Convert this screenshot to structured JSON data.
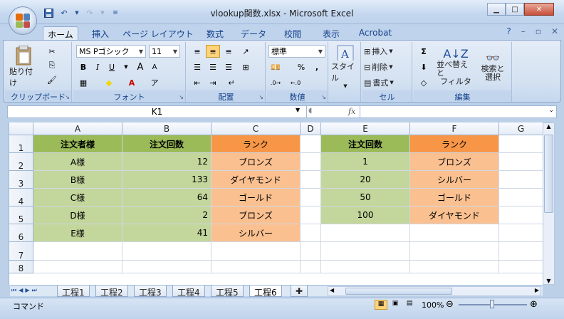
{
  "window": {
    "title": "vlookup関数.xlsx - Microsoft Excel",
    "min_icon": "minimize-icon",
    "max_icon": "maximize-icon",
    "close_icon": "close-icon"
  },
  "tabs": [
    {
      "label": "ホーム",
      "active": true
    },
    {
      "label": "挿入"
    },
    {
      "label": "ページ レイアウト"
    },
    {
      "label": "数式"
    },
    {
      "label": "データ"
    },
    {
      "label": "校閲"
    },
    {
      "label": "表示"
    },
    {
      "label": "Acrobat"
    }
  ],
  "ribbon": {
    "clipboard": {
      "paste": "貼り付け",
      "group": "クリップボード"
    },
    "font": {
      "name": "MS Pゴシック",
      "size": "11",
      "group": "フォント",
      "bold": "B",
      "italic": "I",
      "underline": "U",
      "grow": "A",
      "shrink": "A"
    },
    "alignment": {
      "group": "配置"
    },
    "number": {
      "format": "標準",
      "group": "数値",
      "percent": "%",
      "comma": ","
    },
    "style": {
      "label": "スタイル"
    },
    "cells": {
      "insert": "挿入",
      "delete": "削除",
      "format": "書式",
      "group": "セル"
    },
    "edit": {
      "sigma": "Σ",
      "sort": "並べ替えと",
      "filter": "フィルタ",
      "find": "検索と",
      "select": "選択",
      "group": "編集"
    }
  },
  "formula_bar": {
    "name_box": "K1",
    "fx": "fx",
    "value": ""
  },
  "sheet": {
    "columns": [
      "A",
      "B",
      "C",
      "D",
      "E",
      "F",
      "G"
    ],
    "rows": [
      "1",
      "2",
      "3",
      "4",
      "5",
      "6",
      "7",
      "8"
    ],
    "cells": {
      "A1": "注文者様",
      "B1": "注文回数",
      "C1": "ランク",
      "A2": "A様",
      "B2": "12",
      "C2": "ブロンズ",
      "A3": "B様",
      "B3": "133",
      "C3": "ダイヤモンド",
      "A4": "C様",
      "B4": "64",
      "C4": "ゴールド",
      "A5": "D様",
      "B5": "2",
      "C5": "ブロンズ",
      "A6": "E様",
      "B6": "41",
      "C6": "シルバー",
      "E1": "注文回数",
      "F1": "ランク",
      "E2": "1",
      "F2": "ブロンズ",
      "E3": "20",
      "F3": "シルバー",
      "E4": "50",
      "F4": "ゴールド",
      "E5": "100",
      "F5": "ダイヤモンド"
    },
    "colors": {
      "header_green": "#9bbb59",
      "light_green": "#c3d69b",
      "header_orange": "#f79646",
      "light_orange": "#fac090"
    }
  },
  "sheet_tabs": [
    "工程1",
    "工程2",
    "工程3",
    "工程4",
    "工程5",
    "工程6"
  ],
  "active_sheet": "工程6",
  "status": {
    "mode": "コマンド",
    "zoom": "100%"
  }
}
